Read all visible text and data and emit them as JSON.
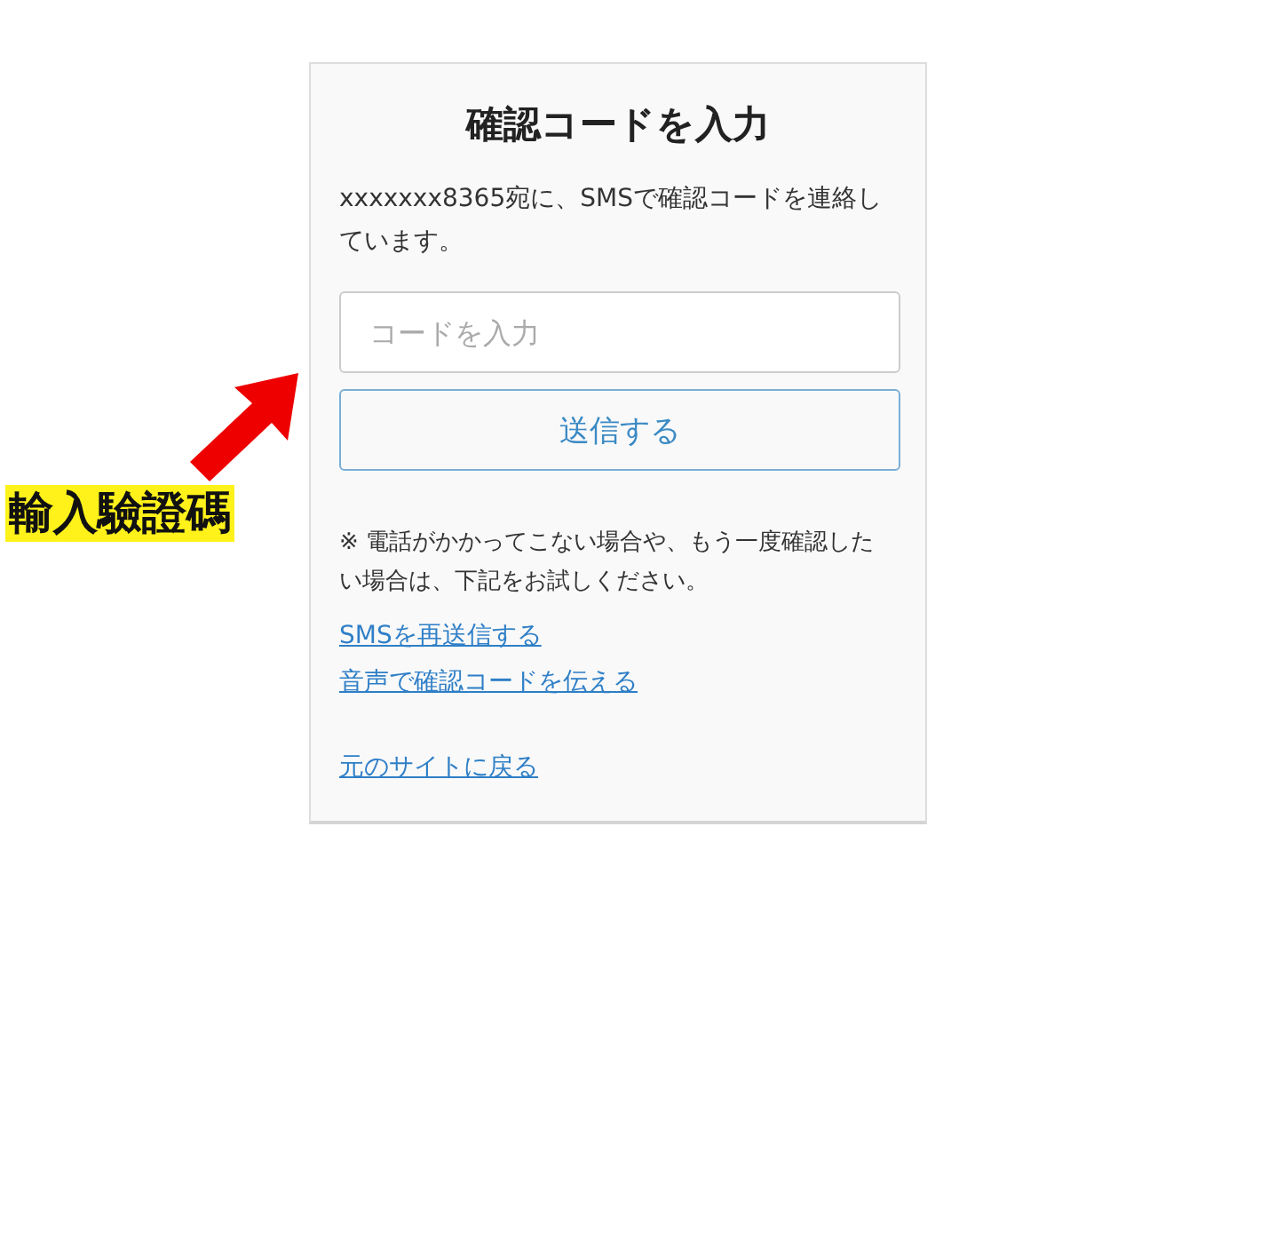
{
  "card": {
    "title": "確認コードを入力",
    "message": "xxxxxxx8365宛に、SMSで確認コードを連絡しています。",
    "code_field": {
      "placeholder": "コードを入力"
    },
    "submit_button": "送信する",
    "note": "※ 電話がかかってこない場合や、もう一度確認したい場合は、下記をお試しください。",
    "links": [
      "SMSを再送信する",
      "音声で確認コードを伝える"
    ],
    "back_link": "元のサイトに戻る"
  },
  "annotation": {
    "label": "輸入驗證碼"
  }
}
